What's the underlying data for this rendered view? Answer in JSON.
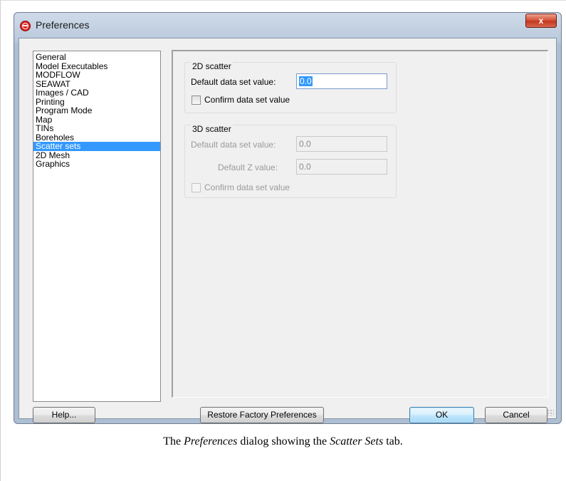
{
  "window": {
    "title": "Preferences",
    "close_label": "x"
  },
  "nav": {
    "items": [
      {
        "label": "General"
      },
      {
        "label": "Model Executables"
      },
      {
        "label": "MODFLOW"
      },
      {
        "label": "SEAWAT"
      },
      {
        "label": "Images / CAD"
      },
      {
        "label": "Printing"
      },
      {
        "label": "Program Mode"
      },
      {
        "label": "Map"
      },
      {
        "label": "TINs"
      },
      {
        "label": "Boreholes"
      },
      {
        "label": "Scatter sets",
        "selected": true
      },
      {
        "label": "2D Mesh"
      },
      {
        "label": "Graphics"
      }
    ]
  },
  "scatter2d": {
    "group_title": "2D scatter",
    "default_label": "Default data set value:",
    "default_value": "0.0",
    "confirm_label": "Confirm data set value",
    "confirm_checked": false
  },
  "scatter3d": {
    "group_title": "3D scatter",
    "default_label": "Default data set value:",
    "default_value": "0.0",
    "z_label": "Default Z value:",
    "z_value": "0.0",
    "confirm_label": "Confirm data set value",
    "confirm_checked": false
  },
  "buttons": {
    "help": "Help...",
    "restore": "Restore Factory Preferences",
    "ok": "OK",
    "cancel": "Cancel"
  },
  "caption": {
    "prefix": "The ",
    "dialog_name": "Preferences",
    "middle": " dialog showing the ",
    "tab_name": "Scatter Sets",
    "suffix": " tab."
  }
}
